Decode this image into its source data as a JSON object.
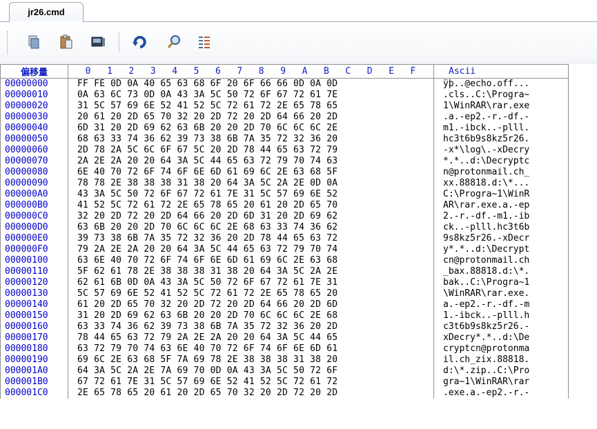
{
  "tab": {
    "title": "jr26.cmd"
  },
  "toolbar": {
    "buttons": [
      "copy-icon",
      "paste-icon",
      "save-icon",
      "refresh-icon",
      "find-icon",
      "columns-icon"
    ]
  },
  "colors": {
    "offset": "#0000cc",
    "header": "#1020c0",
    "border": "#8f8f8f"
  },
  "header": {
    "offset_label": "偏移量",
    "columns": [
      "0",
      "1",
      "2",
      "3",
      "4",
      "5",
      "6",
      "7",
      "8",
      "9",
      "A",
      "B",
      "C",
      "D",
      "E",
      "F"
    ],
    "ascii_label": "Ascii"
  },
  "rows": [
    {
      "offset": "00000000",
      "hex": "FF FE 0D 0A 40 65 63 68 6F 20 6F 66 66 0D 0A 0D",
      "ascii": "ÿþ..@echo.off..."
    },
    {
      "offset": "00000010",
      "hex": "0A 63 6C 73 0D 0A 43 3A 5C 50 72 6F 67 72 61 7E",
      "ascii": ".cls..C:\\Progra~"
    },
    {
      "offset": "00000020",
      "hex": "31 5C 57 69 6E 52 41 52 5C 72 61 72 2E 65 78 65",
      "ascii": "1\\WinRAR\\rar.exe"
    },
    {
      "offset": "00000030",
      "hex": "20 61 20 2D 65 70 32 20 2D 72 20 2D 64 66 20 2D",
      "ascii": ".a.-ep2.-r.-df.-"
    },
    {
      "offset": "00000040",
      "hex": "6D 31 20 2D 69 62 63 6B 20 20 2D 70 6C 6C 6C 2E",
      "ascii": "m1.-ibck..-plll."
    },
    {
      "offset": "00000050",
      "hex": "68 63 33 74 36 62 39 73 38 6B 7A 35 72 32 36 20",
      "ascii": "hc3t6b9s8kz5r26."
    },
    {
      "offset": "00000060",
      "hex": "2D 78 2A 5C 6C 6F 67 5C 20 2D 78 44 65 63 72 79",
      "ascii": "-x*\\log\\.-xDecry"
    },
    {
      "offset": "00000070",
      "hex": "2A 2E 2A 20 20 64 3A 5C 44 65 63 72 79 70 74 63",
      "ascii": "*.*..d:\\Decryptc"
    },
    {
      "offset": "00000080",
      "hex": "6E 40 70 72 6F 74 6F 6E 6D 61 69 6C 2E 63 68 5F",
      "ascii": "n@protonmail.ch_"
    },
    {
      "offset": "00000090",
      "hex": "78 78 2E 38 38 38 31 38 20 64 3A 5C 2A 2E 0D 0A",
      "ascii": "xx.88818.d:\\*..."
    },
    {
      "offset": "000000A0",
      "hex": "43 3A 5C 50 72 6F 67 72 61 7E 31 5C 57 69 6E 52",
      "ascii": "C:\\Progra~1\\WinR"
    },
    {
      "offset": "000000B0",
      "hex": "41 52 5C 72 61 72 2E 65 78 65 20 61 20 2D 65 70",
      "ascii": "AR\\rar.exe.a.-ep"
    },
    {
      "offset": "000000C0",
      "hex": "32 20 2D 72 20 2D 64 66 20 2D 6D 31 20 2D 69 62",
      "ascii": "2.-r.-df.-m1.-ib"
    },
    {
      "offset": "000000D0",
      "hex": "63 6B 20 20 2D 70 6C 6C 6C 2E 68 63 33 74 36 62",
      "ascii": "ck..-plll.hc3t6b"
    },
    {
      "offset": "000000E0",
      "hex": "39 73 38 6B 7A 35 72 32 36 20 2D 78 44 65 63 72",
      "ascii": "9s8kz5r26.-xDecr"
    },
    {
      "offset": "000000F0",
      "hex": "79 2A 2E 2A 20 20 64 3A 5C 44 65 63 72 79 70 74",
      "ascii": "y*.*..d:\\Decrypt"
    },
    {
      "offset": "00000100",
      "hex": "63 6E 40 70 72 6F 74 6F 6E 6D 61 69 6C 2E 63 68",
      "ascii": "cn@protonmail.ch"
    },
    {
      "offset": "00000110",
      "hex": "5F 62 61 78 2E 38 38 38 31 38 20 64 3A 5C 2A 2E",
      "ascii": "_bax.88818.d:\\*."
    },
    {
      "offset": "00000120",
      "hex": "62 61 6B 0D 0A 43 3A 5C 50 72 6F 67 72 61 7E 31",
      "ascii": "bak..C:\\Progra~1"
    },
    {
      "offset": "00000130",
      "hex": "5C 57 69 6E 52 41 52 5C 72 61 72 2E 65 78 65 20",
      "ascii": "\\WinRAR\\rar.exe."
    },
    {
      "offset": "00000140",
      "hex": "61 20 2D 65 70 32 20 2D 72 20 2D 64 66 20 2D 6D",
      "ascii": "a.-ep2.-r.-df.-m"
    },
    {
      "offset": "00000150",
      "hex": "31 20 2D 69 62 63 6B 20 20 2D 70 6C 6C 6C 2E 68",
      "ascii": "1.-ibck..-plll.h"
    },
    {
      "offset": "00000160",
      "hex": "63 33 74 36 62 39 73 38 6B 7A 35 72 32 36 20 2D",
      "ascii": "c3t6b9s8kz5r26.-"
    },
    {
      "offset": "00000170",
      "hex": "78 44 65 63 72 79 2A 2E 2A 20 20 64 3A 5C 44 65",
      "ascii": "xDecry*.*..d:\\De"
    },
    {
      "offset": "00000180",
      "hex": "63 72 79 70 74 63 6E 40 70 72 6F 74 6F 6E 6D 61",
      "ascii": "cryptcn@protonma"
    },
    {
      "offset": "00000190",
      "hex": "69 6C 2E 63 68 5F 7A 69 78 2E 38 38 38 31 38 20",
      "ascii": "il.ch_zix.88818."
    },
    {
      "offset": "000001A0",
      "hex": "64 3A 5C 2A 2E 7A 69 70 0D 0A 43 3A 5C 50 72 6F",
      "ascii": "d:\\*.zip..C:\\Pro"
    },
    {
      "offset": "000001B0",
      "hex": "67 72 61 7E 31 5C 57 69 6E 52 41 52 5C 72 61 72",
      "ascii": "gra~1\\WinRAR\\rar"
    },
    {
      "offset": "000001C0",
      "hex": "2E 65 78 65 20 61 20 2D 65 70 32 20 2D 72 20 2D",
      "ascii": ".exe.a.-ep2.-r.-"
    }
  ]
}
